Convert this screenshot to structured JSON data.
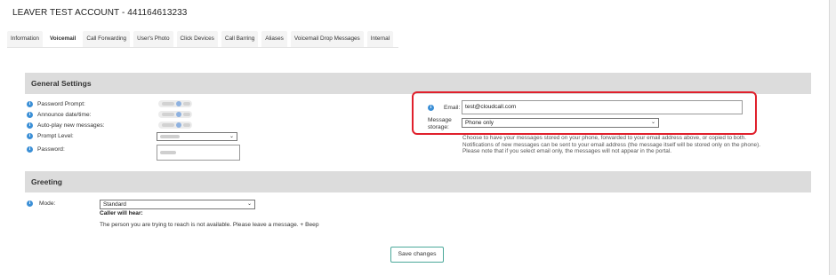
{
  "page": {
    "title": "LEAVER TEST ACCOUNT - 441164613233"
  },
  "tabs": [
    {
      "label": "Information"
    },
    {
      "label": "Voicemail"
    },
    {
      "label": "Call Forwarding"
    },
    {
      "label": "User's Photo"
    },
    {
      "label": "Click Devices"
    },
    {
      "label": "Call Barring"
    },
    {
      "label": "Aliases"
    },
    {
      "label": "Voicemail Drop Messages"
    },
    {
      "label": "Internal"
    }
  ],
  "active_tab": "Voicemail",
  "general_settings": {
    "heading": "General Settings",
    "password_prompt_label": "Password Prompt:",
    "announce_label": "Announce date/time:",
    "autoplay_label": "Auto-play new messages:",
    "prompt_level_label": "Prompt Level:",
    "password_label": "Password:",
    "email_label": "Email:",
    "email_value": "test@cloudcall.com",
    "storage_label_line1": "Message",
    "storage_label_line2": "storage:",
    "storage_value": "Phone only",
    "help_line1": "Choose to have your messages stored on your phone, forwarded to your email address above, or copied to both.",
    "help_line2": "Notifications of new messages can be sent to your email address (the message itself will be stored only on the phone).",
    "help_line3": "Please note that if you select email only, the messages will not appear in the portal."
  },
  "greeting": {
    "heading": "Greeting",
    "mode_label": "Mode:",
    "mode_value": "Standard",
    "caller_title": "Caller will hear:",
    "caller_message": "The person you are trying to reach is not available. Please leave a message. + Beep"
  },
  "actions": {
    "save_label": "Save changes"
  },
  "colors": {
    "info_icon": "#3b8fd6",
    "highlight_border": "#e0202c",
    "save_border": "#4ba89a",
    "section_header_bg": "#dcdcdc"
  },
  "icons": {
    "info": "info-circle-icon",
    "dropdown": "chevron-down-icon"
  }
}
